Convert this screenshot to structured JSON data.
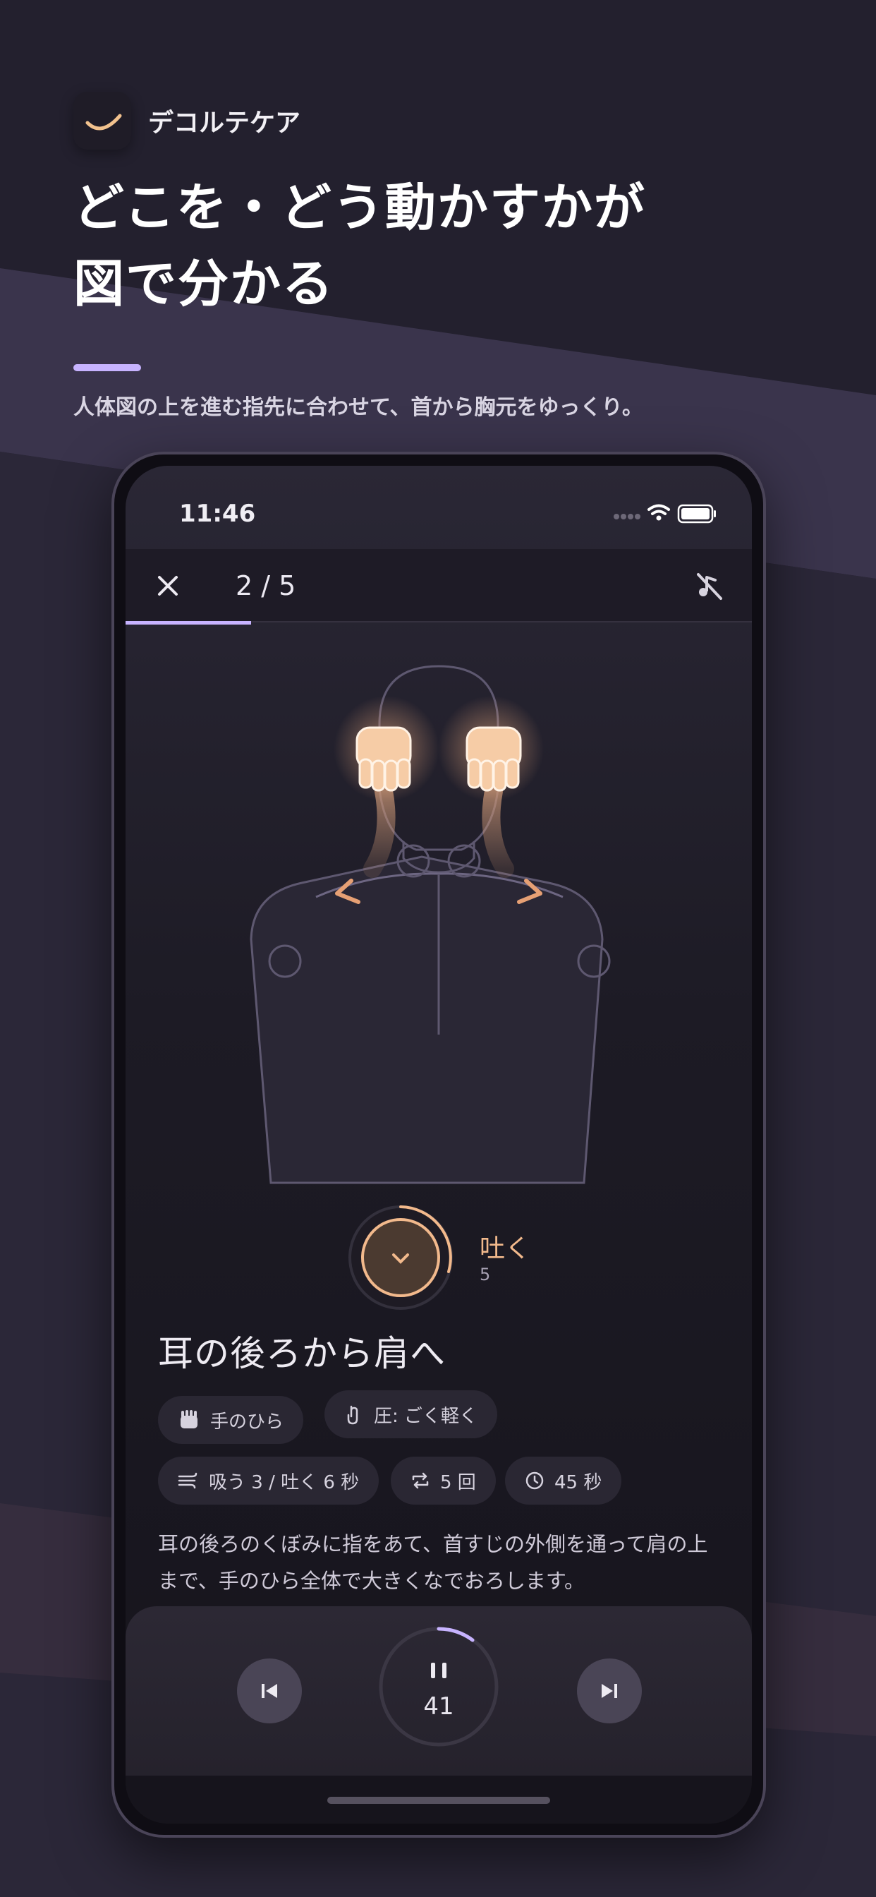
{
  "app": {
    "name": "デコルテケア"
  },
  "promo": {
    "headline_line1": "どこを・どう動かすかが",
    "headline_line2": "図で分かる",
    "subhead": "人体図の上を進む指先に合わせて、首から胸元をゆっくり。"
  },
  "status_bar": {
    "time": "11:46"
  },
  "nav": {
    "step": "2 / 5"
  },
  "progress": {
    "fraction": 0.2
  },
  "breath": {
    "label": "吐く",
    "count": "5"
  },
  "step": {
    "title": "耳の後ろから肩へ",
    "chips_row1": [
      {
        "icon": "palm-icon",
        "label": "手のひら"
      },
      {
        "icon": "touch-pressure-icon",
        "label": "圧: ごく軽く"
      }
    ],
    "chips_row2": [
      {
        "icon": "breath-icon",
        "label": "吸う 3 / 吐く 6 秒"
      },
      {
        "icon": "repeat-icon",
        "label": "5 回"
      },
      {
        "icon": "clock-icon",
        "label": "45 秒"
      }
    ],
    "description": "耳の後ろのくぼみに指をあて、首すじの外側を通って肩の上まで、手のひら全体で大きくなでおろします。"
  },
  "player": {
    "timer": "41"
  },
  "colors": {
    "accent": "#c7b3ff",
    "warm": "#f2b98c",
    "background": "#23202e"
  }
}
